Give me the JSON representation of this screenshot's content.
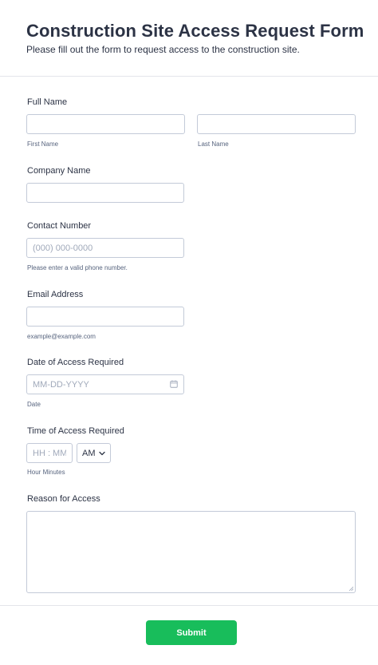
{
  "header": {
    "title": "Construction Site Access Request Form",
    "subtitle": "Please fill out the form to request access to the construction site."
  },
  "fields": {
    "full_name": {
      "label": "Full Name",
      "first_sublabel": "First Name",
      "last_sublabel": "Last Name",
      "first_value": "",
      "last_value": ""
    },
    "company": {
      "label": "Company Name",
      "value": ""
    },
    "contact": {
      "label": "Contact Number",
      "placeholder": "(000) 000-0000",
      "sublabel": "Please enter a valid phone number.",
      "value": ""
    },
    "email": {
      "label": "Email Address",
      "sublabel": "example@example.com",
      "value": ""
    },
    "date": {
      "label": "Date of Access Required",
      "placeholder": "MM-DD-YYYY",
      "sublabel": "Date",
      "icon": "calendar-icon"
    },
    "time": {
      "label": "Time of Access Required",
      "placeholder": "HH : MM",
      "ampm_selected": "AM",
      "sublabel": "Hour Minutes"
    },
    "reason": {
      "label": "Reason for Access",
      "value": ""
    }
  },
  "submit_label": "Submit",
  "colors": {
    "accent": "#18bd5b",
    "text": "#2c3345",
    "border": "#c3cad8",
    "divider": "#e3e5ea"
  }
}
